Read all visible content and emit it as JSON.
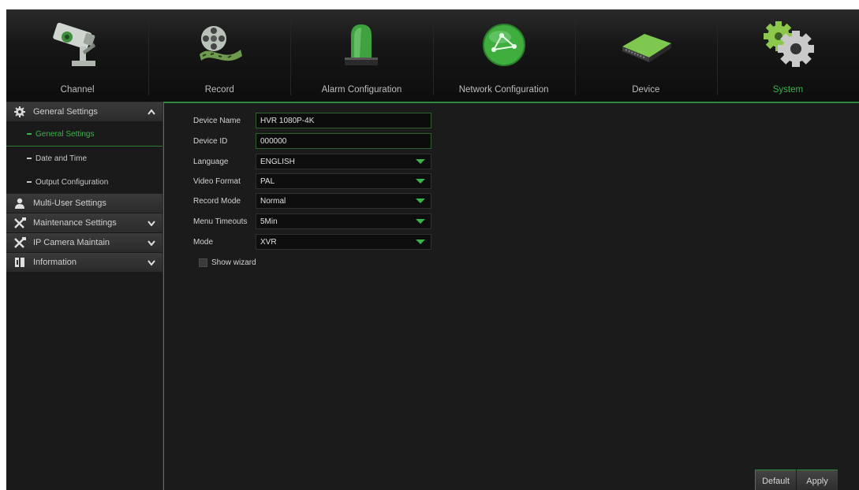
{
  "topnav": {
    "items": [
      {
        "label": "Channel",
        "icon": "security-camera-icon"
      },
      {
        "label": "Record",
        "icon": "film-reel-icon"
      },
      {
        "label": "Alarm Configuration",
        "icon": "alarm-siren-icon"
      },
      {
        "label": "Network Configuration",
        "icon": "network-globe-icon"
      },
      {
        "label": "Device",
        "icon": "hard-drive-icon"
      },
      {
        "label": "System",
        "icon": "gears-icon"
      }
    ],
    "active_label": "System",
    "active_color": "#39b54a"
  },
  "sidebar": {
    "general": {
      "label": "General Settings",
      "icon": "gear-icon",
      "chevron": "chevron-up-icon"
    },
    "general_subitems": [
      {
        "label": "General Settings"
      },
      {
        "label": "Date and Time"
      },
      {
        "label": "Output Configuration"
      }
    ],
    "multi_user": {
      "label": "Multi-User Settings",
      "icon": "user-icon"
    },
    "maintenance": {
      "label": "Maintenance Settings",
      "icon": "tools-icon",
      "chevron": "chevron-down-icon"
    },
    "ip_camera": {
      "label": "IP Camera Maintain",
      "icon": "tools-icon",
      "chevron": "chevron-down-icon"
    },
    "information": {
      "label": "Information",
      "icon": "info-book-icon",
      "chevron": "chevron-down-icon"
    }
  },
  "form": {
    "device_name": {
      "label": "Device Name",
      "value": "HVR 1080P-4K"
    },
    "device_id": {
      "label": "Device ID",
      "value": "000000"
    },
    "language": {
      "label": "Language",
      "value": "ENGLISH"
    },
    "video_format": {
      "label": "Video Format",
      "value": "PAL"
    },
    "record_mode": {
      "label": "Record Mode",
      "value": "Normal"
    },
    "menu_timeouts": {
      "label": "Menu Timeouts",
      "value": "5Min"
    },
    "mode": {
      "label": "Mode",
      "value": "XVR"
    },
    "show_wizard": {
      "label": "Show wizard",
      "checked": false
    }
  },
  "buttons": {
    "default": "Default",
    "apply": "Apply"
  }
}
